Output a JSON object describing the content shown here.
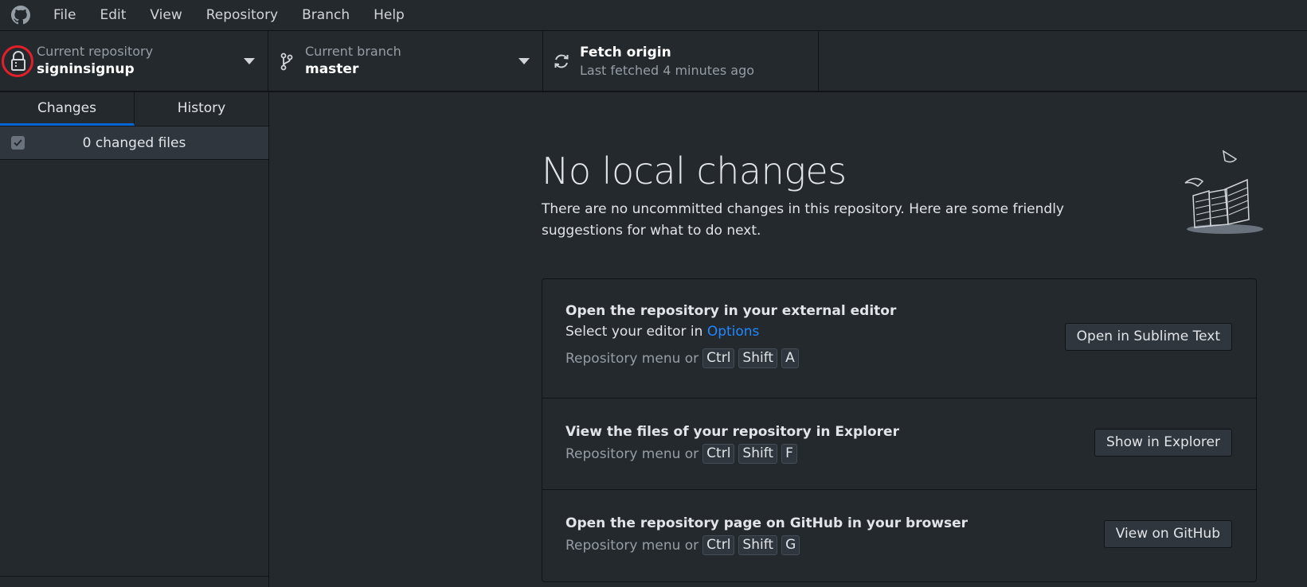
{
  "menubar": {
    "items": [
      "File",
      "Edit",
      "View",
      "Repository",
      "Branch",
      "Help"
    ]
  },
  "toolbar": {
    "repository": {
      "label": "Current repository",
      "value": "signinsignup"
    },
    "branch": {
      "label": "Current branch",
      "value": "master"
    },
    "fetch": {
      "label": "Fetch origin",
      "sub": "Last fetched 4 minutes ago"
    }
  },
  "sidebar": {
    "tabs": [
      "Changes",
      "History"
    ],
    "changed_files": "0 changed files"
  },
  "main": {
    "title": "No local changes",
    "description": "There are no uncommitted changes in this repository. Here are some friendly suggestions for what to do next.",
    "actions": [
      {
        "title": "Open the repository in your external editor",
        "desc_prefix": "Select your editor in ",
        "desc_link": "Options",
        "shortcut_prefix": "Repository menu or",
        "keys": [
          "Ctrl",
          "Shift",
          "A"
        ],
        "button": "Open in Sublime Text"
      },
      {
        "title": "View the files of your repository in Explorer",
        "shortcut_prefix": "Repository menu or",
        "keys": [
          "Ctrl",
          "Shift",
          "F"
        ],
        "button": "Show in Explorer"
      },
      {
        "title": "Open the repository page on GitHub in your browser",
        "shortcut_prefix": "Repository menu or",
        "keys": [
          "Ctrl",
          "Shift",
          "G"
        ],
        "button": "View on GitHub"
      }
    ]
  },
  "colors": {
    "background": "#24292e",
    "accent": "#0366d6",
    "link": "#2188ff",
    "highlight_circle": "#e3202a"
  }
}
